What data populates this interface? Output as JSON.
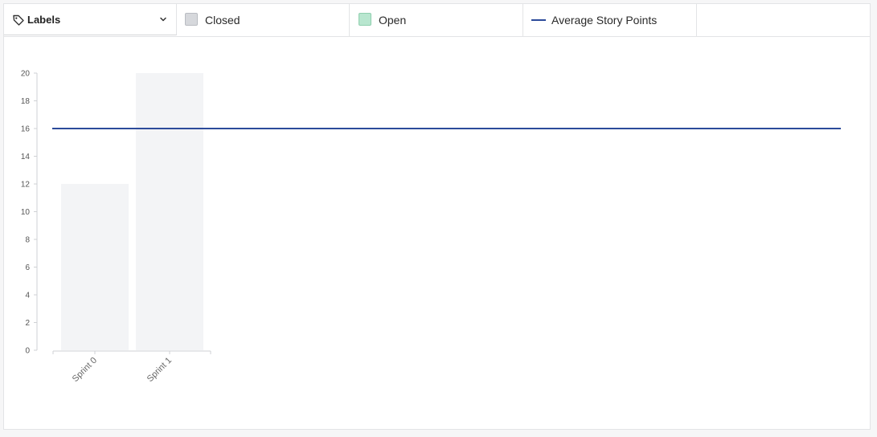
{
  "toolbar": {
    "dropdown_label": "Labels",
    "dropdown_icon": "tag-icon",
    "chevron_icon": "chevron-down-icon"
  },
  "legend": {
    "closed": {
      "label": "Closed",
      "color": "#d6d8dc"
    },
    "open": {
      "label": "Open",
      "color": "#b8e6cf"
    },
    "average": {
      "label": "Average Story Points",
      "color": "#2c4a9a"
    }
  },
  "chart_data": {
    "type": "bar",
    "categories": [
      "Sprint 0",
      "Sprint 1"
    ],
    "series": [
      {
        "name": "Closed",
        "values": [
          12,
          20
        ],
        "color": "#f3f4f6"
      },
      {
        "name": "Open",
        "values": [
          0,
          0
        ],
        "color": "#b8e6cf"
      }
    ],
    "reference_line": {
      "name": "Average Story Points",
      "value": 16,
      "color": "#2c4a9a"
    },
    "yticks": [
      "0",
      "2",
      "4",
      "6",
      "8",
      "10",
      "12",
      "14",
      "16",
      "18",
      "20"
    ],
    "ylim": [
      0,
      20
    ],
    "grid": false,
    "legend_position": "top"
  }
}
